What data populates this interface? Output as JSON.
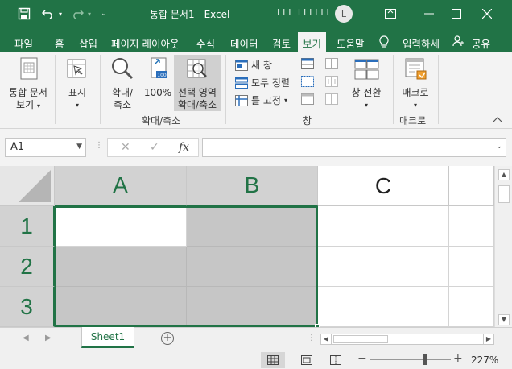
{
  "titlebar": {
    "title": "통합 문서1  -  Excel",
    "user": "LLL LLLLLL",
    "avatar_initial": "L",
    "accent": "#217346"
  },
  "tabs": [
    {
      "label": "파일"
    },
    {
      "label": "홈"
    },
    {
      "label": "삽입"
    },
    {
      "label": "페이지 레이아웃"
    },
    {
      "label": "수식"
    },
    {
      "label": "데이터"
    },
    {
      "label": "검토"
    },
    {
      "label": "보기",
      "active": true
    },
    {
      "label": "도움말"
    },
    {
      "label": "입력하세"
    },
    {
      "label": "공유"
    }
  ],
  "ribbon": {
    "workbook_view_line1": "통합 문서",
    "workbook_view_line2": "보기",
    "show_label": "표시",
    "zoom_line1": "확대/",
    "zoom_line2": "축소",
    "zoom100_label": "100%",
    "zoom_sel_line1": "선택 영역",
    "zoom_sel_line2": "확대/축소",
    "zoom_group": "확대/축소",
    "new_window": "새 창",
    "arrange_all": "모두 정렬",
    "freeze_panes": "틀 고정",
    "window_group": "창",
    "switch_windows": "창 전환",
    "macros_label": "매크로",
    "macros_group": "매크로"
  },
  "formula_bar": {
    "name_box": "A1",
    "fx": "fx",
    "cancel": "✕",
    "enter": "✓",
    "formula": ""
  },
  "grid": {
    "columns": [
      "A",
      "B",
      "C"
    ],
    "rows": [
      "1",
      "2",
      "3"
    ]
  },
  "sheets": [
    {
      "name": "Sheet1"
    }
  ],
  "statusbar": {
    "zoom": "227%"
  }
}
